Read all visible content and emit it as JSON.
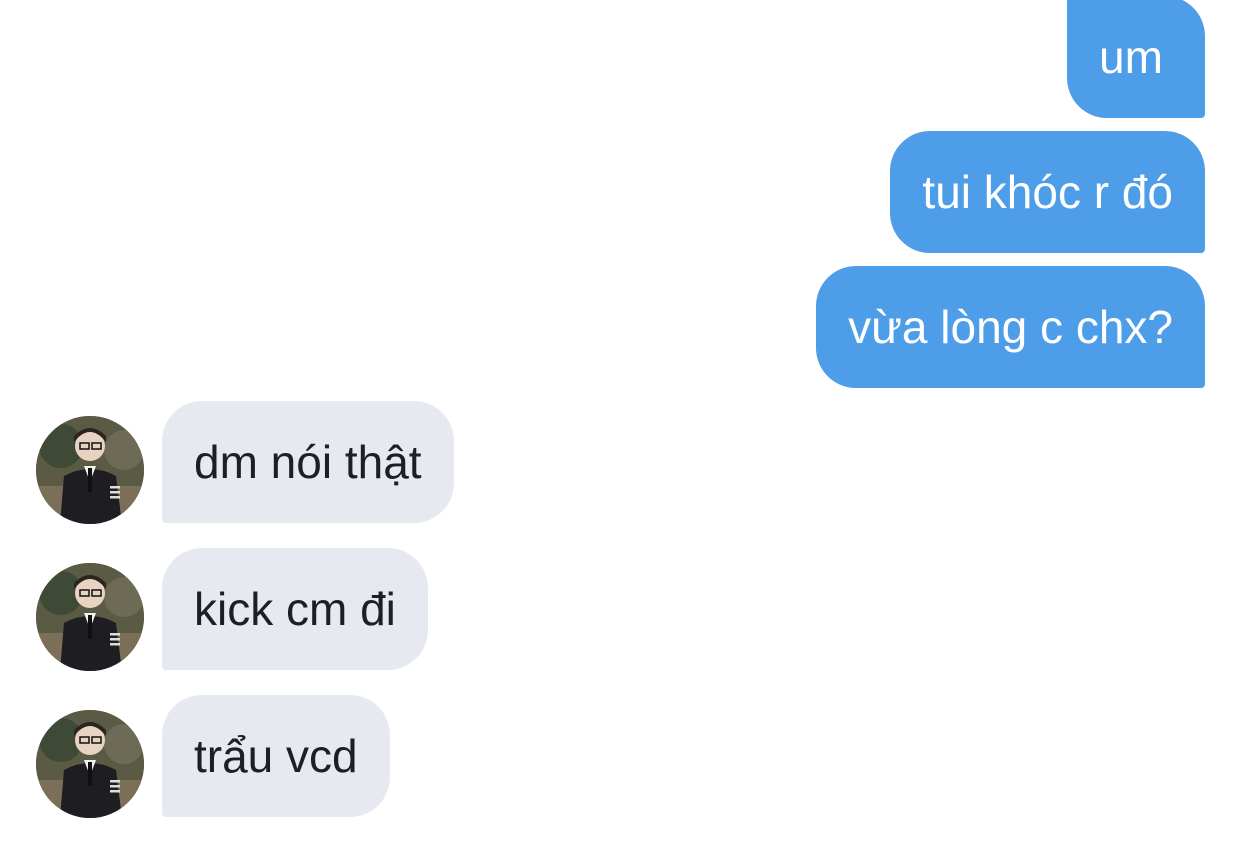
{
  "conversation": {
    "sent": [
      {
        "text": "um"
      },
      {
        "text": "tui khóc r đó"
      },
      {
        "text": "vừa lòng c chx?"
      }
    ],
    "received": [
      {
        "text": "dm nói thật"
      },
      {
        "text": "kick cm đi"
      },
      {
        "text": "trẩu vcd"
      }
    ]
  },
  "colors": {
    "sent_bubble": "#4e9de8",
    "received_bubble": "#e6eaf0",
    "sent_text": "#ffffff",
    "received_text": "#1c1f24"
  }
}
